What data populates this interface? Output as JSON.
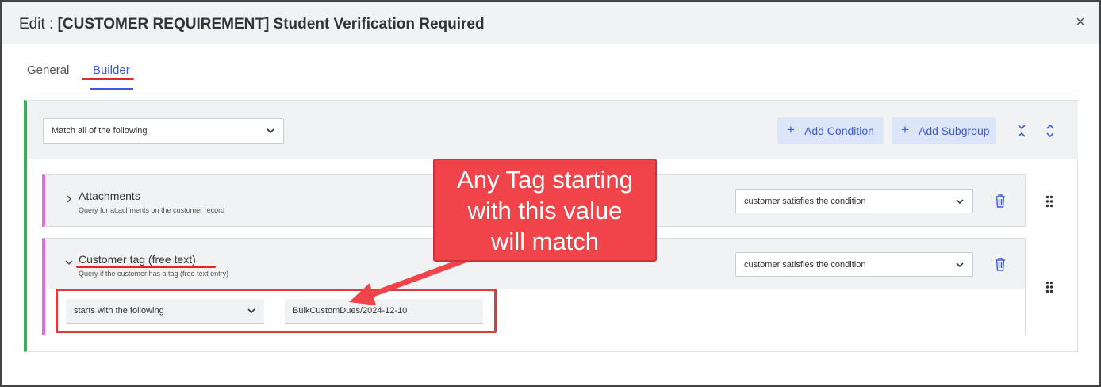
{
  "dialog": {
    "title_prefix": "Edit : ",
    "title_name": "[CUSTOMER REQUIREMENT] Student Verification Required",
    "close_label": "×"
  },
  "tabs": [
    {
      "label": "General",
      "active": false
    },
    {
      "label": "Builder",
      "active": true
    }
  ],
  "builder": {
    "match_select": "Match all of the following",
    "add_condition_label": "Add Condition",
    "add_subgroup_label": "Add Subgroup",
    "conditions": [
      {
        "title": "Attachments",
        "subtitle": "Query for attachments on the customer record",
        "satisfies": "customer satisfies the condition",
        "expanded": false
      },
      {
        "title": "Customer tag (free text)",
        "subtitle": "Query if the customer has a tag (free text entry)",
        "satisfies": "customer satisfies the condition",
        "expanded": true,
        "operator": "starts with the following",
        "value": "BulkCustomDues/2024-12-10"
      }
    ]
  },
  "annotation": {
    "callout_lines": [
      "Any Tag starting",
      "with this value",
      "will match"
    ]
  },
  "colors": {
    "accent": "#3b5bdb",
    "group_border": "#2fb35a",
    "condition_border": "#e36ae0",
    "annotation_red": "#f0444a"
  },
  "icons": [
    "close-icon",
    "plus-icon",
    "collapse-all-icon",
    "expand-all-icon",
    "chevron-right-icon",
    "chevron-down-icon",
    "trash-icon",
    "drag-handle-icon"
  ]
}
